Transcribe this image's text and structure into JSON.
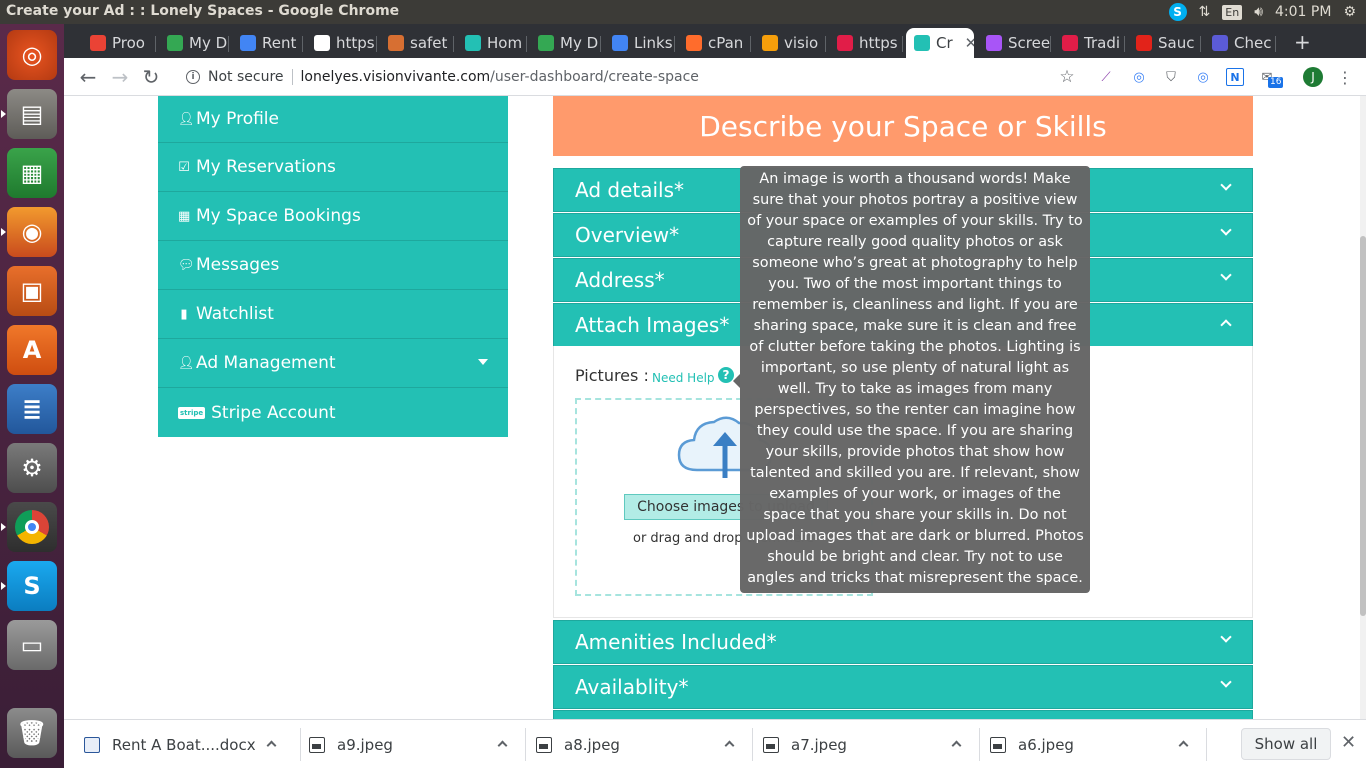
{
  "os": {
    "window_title": "Create your Ad : : Lonely Spaces - Google Chrome",
    "lang": "En",
    "clock": "4:01 PM"
  },
  "launcher": {
    "items": [
      "ubuntu-dash",
      "files",
      "calc",
      "firefox",
      "impress",
      "software-center",
      "writer",
      "system-settings",
      "chrome",
      "skype",
      "disk",
      "trash"
    ]
  },
  "browser": {
    "tabs": [
      {
        "label": "Proo",
        "icon": "gmail-icon",
        "color": "#ea4335"
      },
      {
        "label": "My D",
        "icon": "drive-icon",
        "color": "#34a853"
      },
      {
        "label": "Rent",
        "icon": "docs-icon",
        "color": "#4285f4"
      },
      {
        "label": "https",
        "icon": "trello-icon",
        "color": "#ffffff"
      },
      {
        "label": "safet",
        "icon": "se-icon",
        "color": "#d76f32"
      },
      {
        "label": "Hom",
        "icon": "hex-icon",
        "color": "#23c0b4"
      },
      {
        "label": "My D",
        "icon": "drive-icon",
        "color": "#34a853"
      },
      {
        "label": "Links",
        "icon": "docs-icon",
        "color": "#4285f4"
      },
      {
        "label": "cPan",
        "icon": "cpanel-icon",
        "color": "#ff6c2c"
      },
      {
        "label": "visio",
        "icon": "vision-icon",
        "color": "#f59e0b"
      },
      {
        "label": "https",
        "icon": "app-icon",
        "color": "#e11d48"
      },
      {
        "label": "Cr",
        "icon": "hex-icon",
        "color": "#23c0b4",
        "active": true
      },
      {
        "label": "Scree",
        "icon": "feather-icon",
        "color": "#a855f7"
      },
      {
        "label": "Tradi",
        "icon": "app-icon",
        "color": "#e11d48"
      },
      {
        "label": "Sauc",
        "icon": "sauce-icon",
        "color": "#e2231a"
      },
      {
        "label": "Chec",
        "icon": "s-icon",
        "color": "#5b5bd6"
      }
    ],
    "not_secure": "Not secure",
    "url_host": "lonelyes.visionvivante.com",
    "url_path": "/user-dashboard/create-space",
    "ext_badge": "16",
    "avatar_letter": "J"
  },
  "sidebar": {
    "items": [
      {
        "label": "My Profile",
        "icon": "user-icon"
      },
      {
        "label": "My Reservations",
        "icon": "calendar-check-icon"
      },
      {
        "label": "My Space Bookings",
        "icon": "calendar-icon"
      },
      {
        "label": "Messages",
        "icon": "comments-icon"
      },
      {
        "label": "Watchlist",
        "icon": "bookmark-icon"
      },
      {
        "label": "Ad Management",
        "icon": "user-icon"
      },
      {
        "label": "Stripe Account",
        "icon": "stripe-icon"
      }
    ],
    "stripe_logo_text": "stripe"
  },
  "form": {
    "banner": "Describe your Space or Skills",
    "sections": {
      "ad_details": "Ad details*",
      "overview": "Overview*",
      "address": "Address*",
      "attach_images": "Attach Images*",
      "amenities": "Amenities Included*",
      "availability": "Availablity*"
    },
    "pictures_label": "Pictures :",
    "need_help": "Need Help",
    "choose_images": "Choose images to upload",
    "drag_drop": "or drag and drop them here"
  },
  "tooltip": {
    "text": "An image is worth a thousand words! Make sure that your photos portray a positive view of your space or examples of your skills. Try to capture really good quality photos or ask someone who’s great at photography to help you. Two of the most important things to remember is, cleanliness and light. If you are sharing space, make sure it is clean and free of clutter before taking the photos. Lighting is important, so use plenty of natural light as well. Try to take as images from many perspectives, so the renter can imagine how they could use the space. If you are sharing your skills, provide photos that show how talented and skilled you are. If relevant, show examples of your work, or images of the space that you share your skills in. Do not upload images that are dark or blurred. Photos should be bright and clear. Try not to use angles and tricks that misrepresent the space."
  },
  "downloads": {
    "items": [
      {
        "name": "Rent A Boat....docx",
        "type": "word"
      },
      {
        "name": "a9.jpeg",
        "type": "image"
      },
      {
        "name": "a8.jpeg",
        "type": "image"
      },
      {
        "name": "a7.jpeg",
        "type": "image"
      },
      {
        "name": "a6.jpeg",
        "type": "image"
      }
    ],
    "show_all": "Show all"
  }
}
